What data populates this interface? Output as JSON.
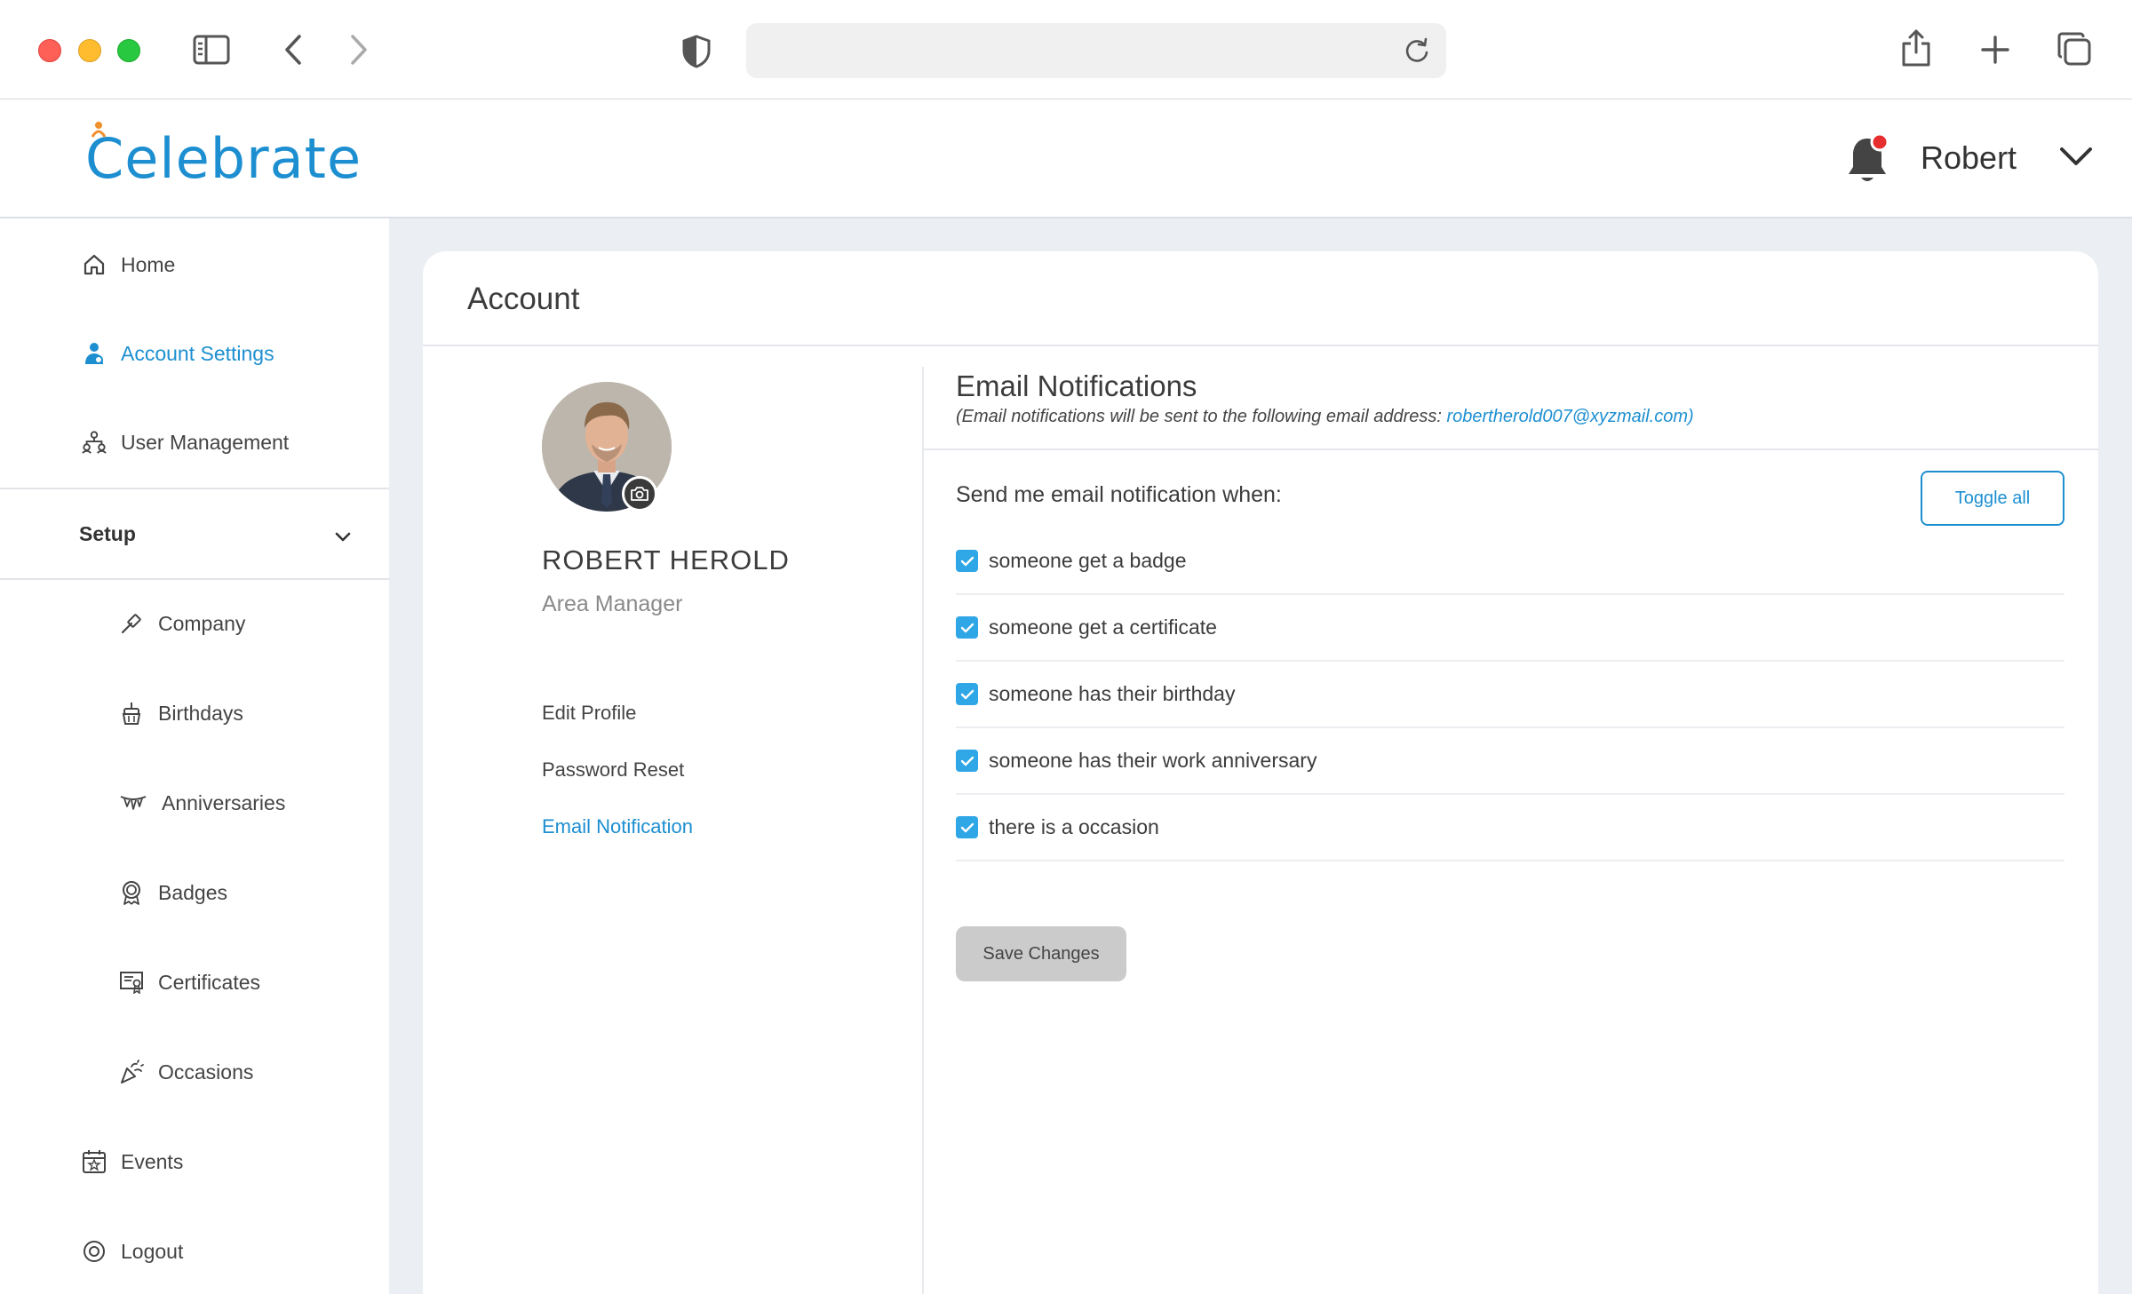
{
  "header": {
    "logo_text": "Celebrate",
    "user_name": "Robert"
  },
  "sidebar": {
    "items": [
      {
        "label": "Home"
      },
      {
        "label": "Account Settings"
      },
      {
        "label": "User Management"
      }
    ],
    "setup_label": "Setup",
    "setup_items": [
      {
        "label": "Company"
      },
      {
        "label": "Birthdays"
      },
      {
        "label": "Anniversaries"
      },
      {
        "label": "Badges"
      },
      {
        "label": "Certificates"
      },
      {
        "label": "Occasions"
      }
    ],
    "events_label": "Events",
    "logout_label": "Logout"
  },
  "account": {
    "title": "Account",
    "profile": {
      "name": "ROBERT HEROLD",
      "role": "Area Manager"
    },
    "links": [
      {
        "label": "Edit Profile"
      },
      {
        "label": "Password Reset"
      },
      {
        "label": "Email Notification"
      }
    ]
  },
  "email": {
    "title": "Email Notifications",
    "subtitle_prefix": "(Email notifications will be sent to the following email address: ",
    "address": "robertherold007@xyzmail.com",
    "subtitle_suffix": ")",
    "prompt": "Send me email notification when:",
    "toggle_label": "Toggle all",
    "options": [
      {
        "label": "someone get a badge",
        "checked": true
      },
      {
        "label": "someone get a certificate",
        "checked": true
      },
      {
        "label": "someone has their birthday",
        "checked": true
      },
      {
        "label": "someone has their work anniversary",
        "checked": true
      },
      {
        "label": "there is a occasion",
        "checked": true
      }
    ],
    "save_label": "Save Changes"
  },
  "colors": {
    "accent": "#1d8fd1",
    "checkbox": "#2fa6e6",
    "notification_dot": "#e62e2e"
  }
}
